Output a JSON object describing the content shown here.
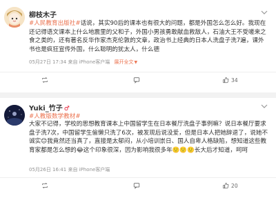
{
  "posts": [
    {
      "username": "柳枝木子",
      "hashtag": "#人民教育出版社#",
      "body": "话说，其实90后的课本也有很大的问题，都是外国怎么怎么好。我现在还记得语文课本上什么地震里的父和子，外国小男孩勇敢献血救敌人，石油大王不受嗟来之食之类的，还有著名反华作家杰克伦敦的文章，政治书上经典的日本人洗盘子洗7遍，课外书也是疯狂宣传外国，什么聪明的犹太人，什么德",
      "time": "05月27日 17:34",
      "source": "来自 iPhone客户端",
      "expand_label": "展开全文",
      "actions": {
        "repost": "",
        "comment": "",
        "like": "34"
      }
    },
    {
      "username": "Yuki_竹子",
      "vip_mark": "♂",
      "hashtag": "#人教版数学教材#",
      "body": "大家不记得，学校的思想教育课本上中国留学生在日本餐厅洗盘子事例嘛？说日本餐厅要求盘子洗7次，中国留学生偷懒只洗了6次，被发现后说没爱，但是日本人把她辞退了，说她不诚实😊我竟然还当真了，直接是太郁闷，从小培训崇日、国人自卑人格缺陷，想知道这些教育家都是怎么想的😂这个印象很深，因为影响我很多年🙂🙂🙂长大后才知道，呵呵",
      "time": "05月26日 16:41",
      "source": "来自 iPhone客户端",
      "actions": {
        "repost": "",
        "comment": "",
        "like": "20"
      }
    }
  ],
  "colors": {
    "hashtag": "#eb7350",
    "meta": "#939393",
    "text": "#333333"
  },
  "icons": [
    "repost-icon",
    "comment-icon",
    "like-icon",
    "more-icon",
    "avatar"
  ]
}
